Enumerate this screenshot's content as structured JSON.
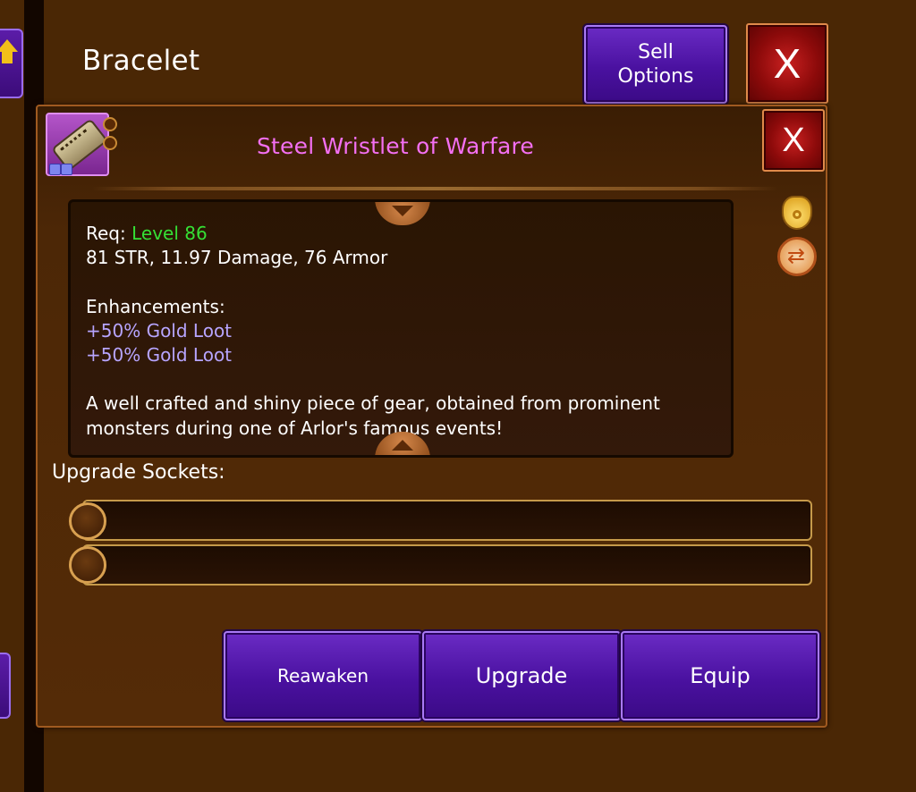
{
  "header": {
    "title": "Bracelet",
    "sell_options_label": "Sell\nOptions",
    "close_label": "X"
  },
  "item": {
    "name": "Steel Wristlet of Warfare",
    "close_label": "X",
    "req_label": "Req:",
    "req_value": "Level 86",
    "stats": "81 STR, 11.97 Damage, 76 Armor",
    "enhancements_label": "Enhancements:",
    "enhancements": [
      "+50% Gold Loot",
      "+50% Gold Loot"
    ],
    "description": "A well crafted and shiny piece of gear, obtained from prominent monsters during one of Arlor's famous events!"
  },
  "sockets": {
    "label": "Upgrade Sockets:",
    "count": 2
  },
  "actions": {
    "reawaken": "Reawaken",
    "upgrade": "Upgrade",
    "equip": "Equip"
  },
  "icons": {
    "side": [
      "gold-bag-icon",
      "swap-icon"
    ],
    "item": "bracelet-icon"
  },
  "colors": {
    "item_name": "#f36ff2",
    "level_req": "#35e035",
    "enhancement": "#b7a5ff",
    "button_purple": "#4a11a0",
    "close_red": "#a81414"
  }
}
